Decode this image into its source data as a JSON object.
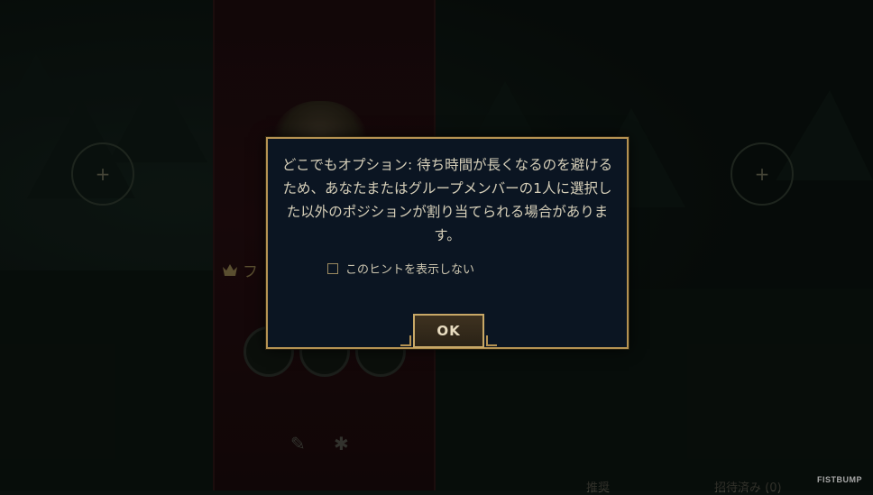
{
  "dialog": {
    "message": "どこでもオプション: 待ち時間が長くなるのを避けるため、あなたまたはグループメンバーの1人に選択した以外のポジションが割り当てられる場合があります。",
    "hint_checkbox_label": "このヒントを表示しない",
    "hint_checked": false,
    "ok_label": "OK"
  },
  "background": {
    "left_slot_icon": "plus-icon",
    "right_slot_icon": "plus-icon",
    "crown_label": "フ",
    "bottom_left_text": "推奨",
    "bottom_right_text": "招待済み (0)"
  },
  "watermark": "FISTBUMP",
  "colors": {
    "dialog_border": "#b59252",
    "dialog_bg": "#0b1522",
    "text": "#d6cfb9"
  }
}
